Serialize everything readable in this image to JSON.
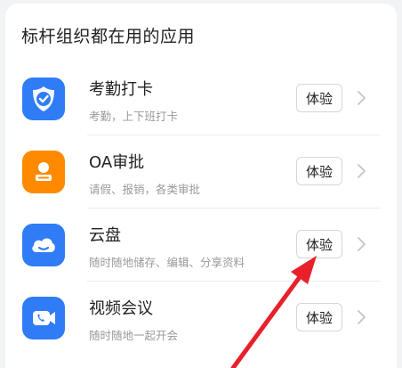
{
  "section": {
    "title": "标杆组织都在用的应用"
  },
  "apps": [
    {
      "name": "考勤打卡",
      "desc": "考勤，上下班打卡",
      "button": "体验",
      "icon": "check-shield-icon",
      "color": "#2f7cf6"
    },
    {
      "name": "OA审批",
      "desc": "请假、报销，各类审批",
      "button": "体验",
      "icon": "id-card-icon",
      "color": "#ff8a00"
    },
    {
      "name": "云盘",
      "desc": "随时随地储存、编辑、分享资料",
      "button": "体验",
      "icon": "cloud-icon",
      "color": "#2f7cf6"
    },
    {
      "name": "视频会议",
      "desc": "随时随地一起开会",
      "button": "体验",
      "icon": "video-call-icon",
      "color": "#2f7cf6"
    }
  ],
  "annotation": {
    "arrow_color": "#e8202a"
  }
}
